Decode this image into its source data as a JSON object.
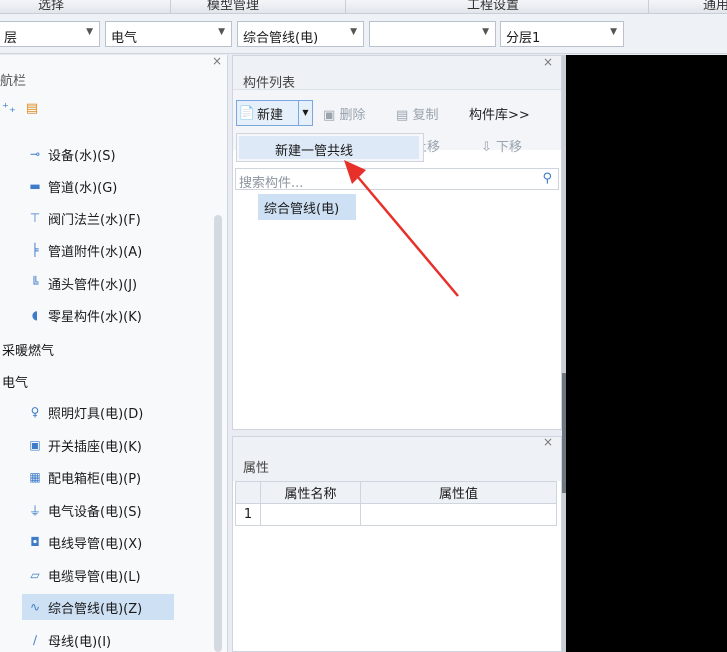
{
  "ribbon": {
    "tabs": [
      "选择",
      "模型管理",
      "工程设置",
      "通用"
    ]
  },
  "toolbar": {
    "floor": "层",
    "discipline": "电气",
    "component_type": "综合管线(电)",
    "component_name": "",
    "layer": "分层1"
  },
  "nav": {
    "title": "航栏",
    "items": [
      {
        "label": "设备(水)(S)",
        "icon": "pipe-equipment-icon",
        "glyph": "⊸"
      },
      {
        "label": "管道(水)(G)",
        "icon": "pipe-icon",
        "glyph": "▬"
      },
      {
        "label": "阀门法兰(水)(F)",
        "icon": "valve-icon",
        "glyph": "⊤"
      },
      {
        "label": "管道附件(水)(A)",
        "icon": "pipe-accessory-icon",
        "glyph": "╞"
      },
      {
        "label": "通头管件(水)(J)",
        "icon": "pipe-fitting-icon",
        "glyph": "╚"
      },
      {
        "label": "零星构件(水)(K)",
        "icon": "misc-component-icon",
        "glyph": "◖"
      }
    ],
    "groups": [
      "采暖燃气",
      "电气"
    ],
    "electric_items": [
      {
        "label": "照明灯具(电)(D)",
        "icon": "lamp-icon",
        "glyph": "♀"
      },
      {
        "label": "开关插座(电)(K)",
        "icon": "switch-socket-icon",
        "glyph": "▣"
      },
      {
        "label": "配电箱柜(电)(P)",
        "icon": "distribution-box-icon",
        "glyph": "▦"
      },
      {
        "label": "电气设备(电)(S)",
        "icon": "electrical-equipment-icon",
        "glyph": "⏚"
      },
      {
        "label": "电线导管(电)(X)",
        "icon": "wire-conduit-icon",
        "glyph": "◘"
      },
      {
        "label": "电缆导管(电)(L)",
        "icon": "cable-conduit-icon",
        "glyph": "▱"
      },
      {
        "label": "综合管线(电)(Z)",
        "icon": "integrated-pipeline-icon",
        "glyph": "∿",
        "selected": true
      },
      {
        "label": "母线(电)(I)",
        "icon": "busbar-icon",
        "glyph": "∕"
      }
    ]
  },
  "component_list": {
    "title": "构件列表",
    "new_label": "新建",
    "delete_label": "删除",
    "copy_label": "复制",
    "library_label": "构件库>>",
    "move_up_label": "上移",
    "move_down_label": "下移",
    "search_placeholder": "搜索构件...",
    "tree_item": "综合管线(电)",
    "dropdown_item": "新建一管共线"
  },
  "properties": {
    "title": "属性",
    "col_name": "属性名称",
    "col_value": "属性值",
    "row_number": "1"
  },
  "colors": {
    "selection": "#cde0f4",
    "annotation_arrow": "#e8302a",
    "canvas": "#000000"
  }
}
